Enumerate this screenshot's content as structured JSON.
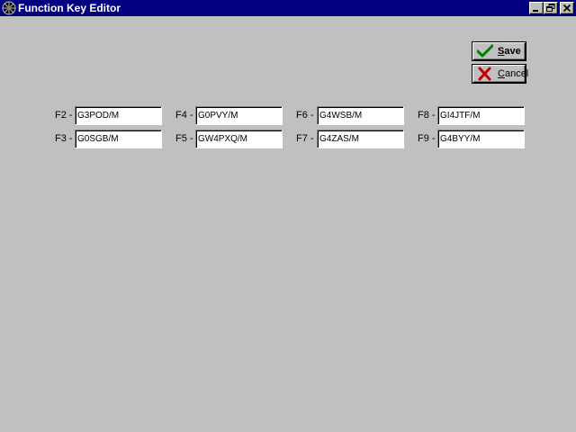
{
  "window": {
    "title": "Function Key Editor",
    "icon": "app-icon",
    "controls": [
      "minimize-icon",
      "restore-icon",
      "close-icon"
    ]
  },
  "buttons": {
    "save_label": "Save",
    "save_icon": "checkmark-icon",
    "cancel_label": "Cancel",
    "cancel_icon": "x-icon"
  },
  "function_keys": [
    {
      "key": "F2 -",
      "value": "G3POD/M"
    },
    {
      "key": "F3 -",
      "value": "G0SGB/M"
    },
    {
      "key": "F4 -",
      "value": "G0PVY/M"
    },
    {
      "key": "F5 -",
      "value": "GW4PXQ/M"
    },
    {
      "key": "F6 -",
      "value": "G4WSB/M"
    },
    {
      "key": "F7 -",
      "value": "G4ZAS/M"
    },
    {
      "key": "F8 -",
      "value": "GI4JTF/M"
    },
    {
      "key": "F9 -",
      "value": "G4BYY/M"
    }
  ],
  "colors": {
    "titlebar": "#000080",
    "background": "#c0c0c0",
    "save_check": "#008000",
    "cancel_x": "#c00000"
  }
}
